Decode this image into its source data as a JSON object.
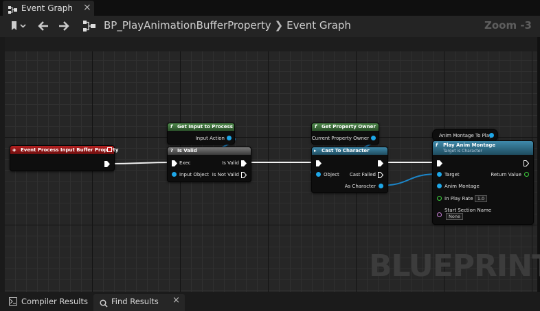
{
  "tab": {
    "label": "Event Graph",
    "close": "×"
  },
  "toolbar": {
    "breadcrumb_blueprint": "BP_PlayAnimationBufferProperty",
    "breadcrumb_separator": "❯",
    "breadcrumb_graph": "Event Graph",
    "zoom": "Zoom -3"
  },
  "nodes": {
    "event": {
      "title": "Event Process Input Buffer Property",
      "color": "#a01a1a"
    },
    "get_input": {
      "title": "Get Input to Process",
      "pin_out": "Input Action",
      "color": "#3b6f3a"
    },
    "is_valid": {
      "title": "Is Valid",
      "pin_exec": "Exec",
      "pin_input_object": "Input Object",
      "pin_is_valid": "Is Valid",
      "pin_is_not_valid": "Is Not Valid",
      "color": "#5a5a5a"
    },
    "get_owner": {
      "title": "Get Property Owner",
      "pin_out": "Current Property Owner",
      "color": "#3b6f3a"
    },
    "cast": {
      "title": "Cast To Character",
      "pin_object": "Object",
      "pin_cast_failed": "Cast Failed",
      "pin_as_character": "As Character",
      "color": "#2f6f8a"
    },
    "montage_var": {
      "title": "Anim Montage To Play"
    },
    "play_montage": {
      "title": "Play Anim Montage",
      "subtitle": "Target is Character",
      "pin_target": "Target",
      "pin_anim_montage": "Anim Montage",
      "pin_in_play_rate": "In Play Rate",
      "in_play_rate_value": "1.0",
      "pin_start_section": "Start Section Name",
      "start_section_value": "None",
      "pin_return_value": "Return Value",
      "color": "#2f6f8a"
    }
  },
  "watermark": "BLUEPRINT",
  "bottom": {
    "compiler_results": "Compiler Results",
    "find_results": "Find Results",
    "close": "×"
  },
  "colors": {
    "exec": "#ffffff",
    "object_pin": "#1ea7e8",
    "float_pin": "#3dd13d",
    "name_pin": "#c77fd6",
    "wire_object": "#1c86c9"
  }
}
